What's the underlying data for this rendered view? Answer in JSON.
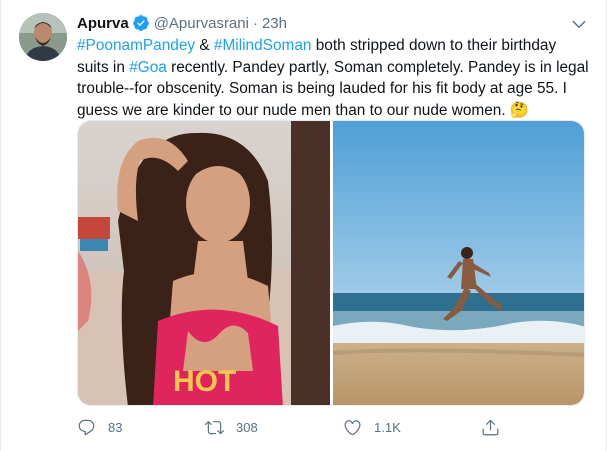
{
  "tweet": {
    "author": {
      "display_name": "Apurva",
      "handle": "@Apurvasrani",
      "verified": true,
      "time": "23h",
      "separator": "·",
      "avatar_icon": "profile-photo"
    },
    "text": {
      "hashtag_1": "#PoonamPandey",
      "t1": " & ",
      "hashtag_2": "#MilindSoman",
      "t2": " both stripped down to their birthday suits in ",
      "hashtag_3": "#Goa",
      "t3": " recently. Pandey partly, Soman completely. Pandey is in legal trouble--for obscenity. Soman is being lauded for his fit body at age 55. I guess we are kinder to our nude men than to our nude women. ",
      "emoji": "🤔"
    },
    "media": {
      "left_photo": "woman-in-pink-swimsuit-on-beach",
      "right_photo": "man-running-on-beach",
      "left_logo_text": "HOT"
    },
    "actions": {
      "reply_count": "83",
      "retweet_count": "308",
      "like_count": "1.1K"
    },
    "colors": {
      "link": "#1da1f2",
      "verified": "#1da1f2",
      "secondary_text": "#5b7083"
    },
    "icons": [
      "verified-badge-icon",
      "caret-down-icon",
      "reply-icon",
      "retweet-icon",
      "like-icon",
      "share-icon"
    ]
  }
}
